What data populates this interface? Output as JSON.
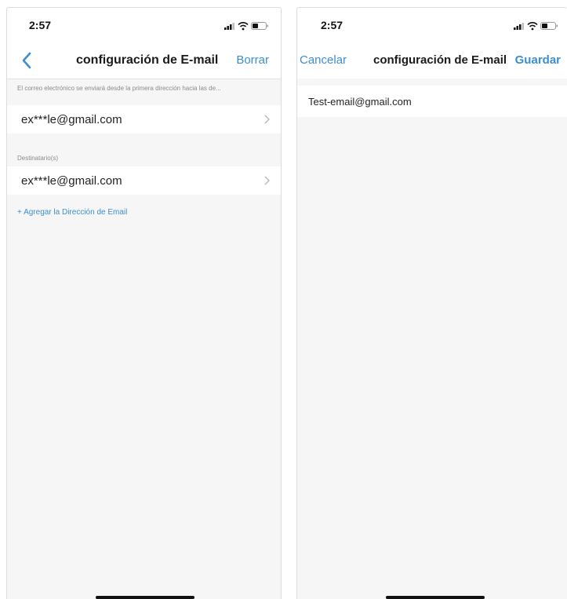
{
  "screen1": {
    "status": {
      "time": "2:57"
    },
    "nav": {
      "back_icon": "chevron-left-icon",
      "title": "configuración de E-mail",
      "action": "Borrar"
    },
    "sender_note": "El correo electrónico se enviará desde la primera dirección hacia las de...",
    "sender": {
      "email": "ex***le@gmail.com"
    },
    "recipients_header": "Destinatario(s)",
    "recipients": [
      {
        "email": "ex***le@gmail.com"
      }
    ],
    "add_link": "+ Agregar la Dirección de Email"
  },
  "screen2": {
    "status": {
      "time": "2:57"
    },
    "nav": {
      "cancel": "Cancelar",
      "title": "configuración de E-mail",
      "save": "Guardar"
    },
    "email_input": {
      "value": "Test-email@gmail.com"
    }
  },
  "colors": {
    "accent": "#3b8fd0",
    "background": "#f6f6f6",
    "surface": "#ffffff"
  }
}
